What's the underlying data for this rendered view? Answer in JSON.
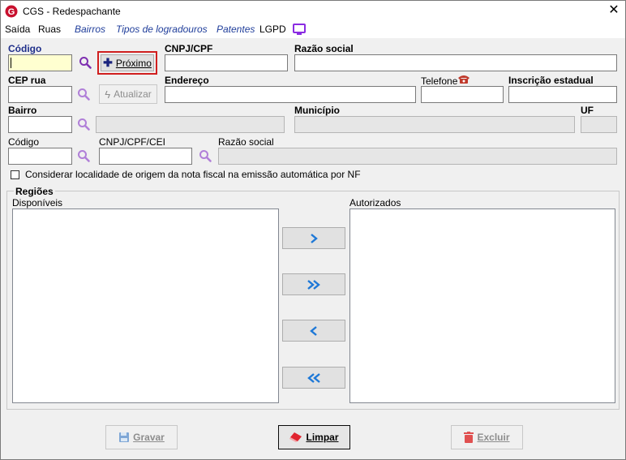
{
  "window": {
    "title": "CGS - Redespachante",
    "close_glyph": "✕"
  },
  "menu": [
    "Saída",
    "Ruas",
    "Bairros",
    "Tipos de logradouros",
    "Patentes",
    "LGPD"
  ],
  "form": {
    "codigo_label": "Código",
    "proximo_label": "Próximo",
    "cnpj_label": "CNPJ/CPF",
    "razao_label": "Razão social",
    "cep_label": "CEP rua",
    "atualizar_label": "Atualizar",
    "endereco_label": "Endereço",
    "telefone_label": "Telefone",
    "ie_label": "Inscrição estadual",
    "bairro_label": "Bairro",
    "municipio_label": "Município",
    "uf_label": "UF",
    "codigo2_label": "Código",
    "cnpjcei_label": "CNPJ/CPF/CEI",
    "razao2_label": "Razão social",
    "checkbox_label": "Considerar localidade de origem da nota fiscal na emissão automática por NF"
  },
  "regioes": {
    "group_label": "Regiões",
    "disponiveis_label": "Disponíveis",
    "autorizados_label": "Autorizados",
    "move_right": "›",
    "move_all_right": "»",
    "move_left": "‹",
    "move_all_left": "«"
  },
  "footer": {
    "gravar": "Gravar",
    "limpar": "Limpar",
    "excluir": "Excluir"
  },
  "colors": {
    "accent_blue": "#1e78d7",
    "magnifier": "#9b59d0",
    "highlight_red": "#d01f1f",
    "app_logo": "#c8102e"
  }
}
